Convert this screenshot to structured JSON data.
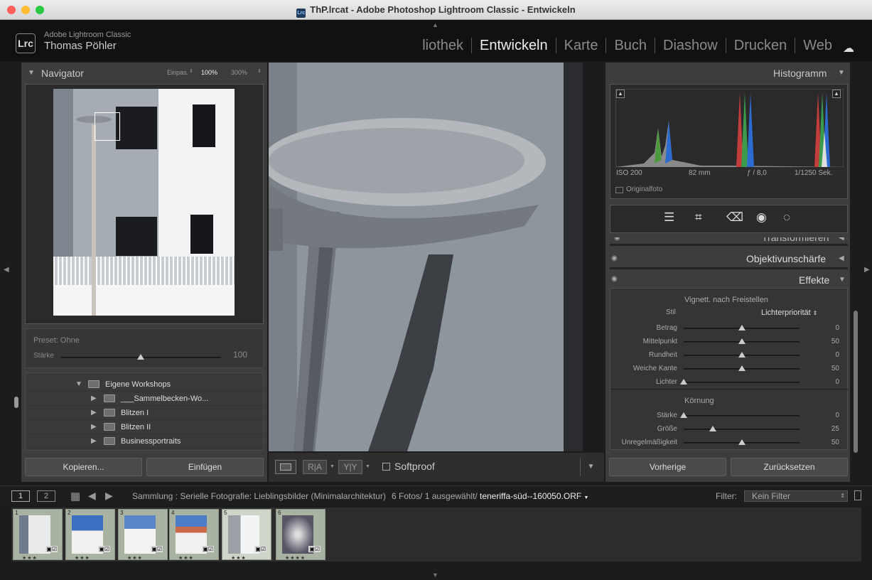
{
  "window": {
    "title": "ThP.lrcat - Adobe Photoshop Lightroom Classic - Entwickeln"
  },
  "identity": {
    "app_line": "Adobe Lightroom Classic",
    "user": "Thomas Pöhler",
    "logo": "Lrc"
  },
  "modules": [
    "liothek",
    "Entwickeln",
    "Karte",
    "Buch",
    "Diashow",
    "Drucken",
    "Web"
  ],
  "active_module": "Entwickeln",
  "navigator": {
    "title": "Navigator",
    "zoom_fit": "Einpas.",
    "zoom_100": "100%",
    "zoom_300": "300%"
  },
  "preset": {
    "label": "Preset: Ohne",
    "strength_label": "Stärke",
    "strength_value": "100",
    "strength_fraction": 0.5
  },
  "folders": [
    {
      "name": "Eigene Workshops",
      "level": 0,
      "expanded": true
    },
    {
      "name": "___Sammelbecken-Wo...",
      "level": 1,
      "expanded": false
    },
    {
      "name": "Blitzen I",
      "level": 1,
      "expanded": false
    },
    {
      "name": "Blitzen II",
      "level": 1,
      "expanded": false
    },
    {
      "name": "Businessportraits",
      "level": 1,
      "expanded": false
    }
  ],
  "left_buttons": {
    "copy": "Kopieren...",
    "paste": "Einfügen"
  },
  "toolbar": {
    "softproof": "Softproof",
    "ra": "R|A",
    "yy": "Y|Y"
  },
  "histogram": {
    "title": "Histogramm",
    "iso": "ISO 200",
    "focal": "82 mm",
    "aperture": "ƒ / 8,0",
    "shutter": "1/1250 Sek.",
    "original_label": "Originalfoto"
  },
  "panels": {
    "transform": "Transformieren",
    "lens": "Objektivunschärfe",
    "effects": "Effekte"
  },
  "vignette": {
    "title": "Vignett. nach Freistellen",
    "style_label": "Stil",
    "style_value": "Lichterpriorität",
    "sliders": [
      {
        "label": "Betrag",
        "value": "0",
        "fraction": 0.5
      },
      {
        "label": "Mittelpunkt",
        "value": "50",
        "fraction": 0.5
      },
      {
        "label": "Rundheit",
        "value": "0",
        "fraction": 0.5
      },
      {
        "label": "Weiche Kante",
        "value": "50",
        "fraction": 0.5
      },
      {
        "label": "Lichter",
        "value": "0",
        "fraction": 0.0
      }
    ]
  },
  "grain": {
    "title": "Körnung",
    "sliders": [
      {
        "label": "Stärke",
        "value": "0",
        "fraction": 0.0
      },
      {
        "label": "Größe",
        "value": "25",
        "fraction": 0.25
      },
      {
        "label": "Unregelmäßigkeit",
        "value": "50",
        "fraction": 0.5
      }
    ]
  },
  "right_buttons": {
    "previous": "Vorherige",
    "reset": "Zurücksetzen"
  },
  "filmbar": {
    "view1": "1",
    "view2": "2",
    "source": "Sammlung : Serielle Fotografie: Lieblingsbilder (Minimalarchitektur)",
    "count": "6 Fotos/ 1 ausgewählt/",
    "filename": "teneriffa-süd--160050.ORF",
    "filter_label": "Filter:",
    "filter_value": "Kein Filter"
  },
  "filmstrip": [
    {
      "num": "1",
      "stars": "★★★",
      "selected": false
    },
    {
      "num": "2",
      "stars": "★★★",
      "selected": false
    },
    {
      "num": "3",
      "stars": "★★★",
      "selected": false
    },
    {
      "num": "4",
      "stars": "★★★",
      "selected": false
    },
    {
      "num": "5",
      "stars": "★★★",
      "selected": true
    },
    {
      "num": "6",
      "stars": "★★★★",
      "selected": false
    }
  ]
}
